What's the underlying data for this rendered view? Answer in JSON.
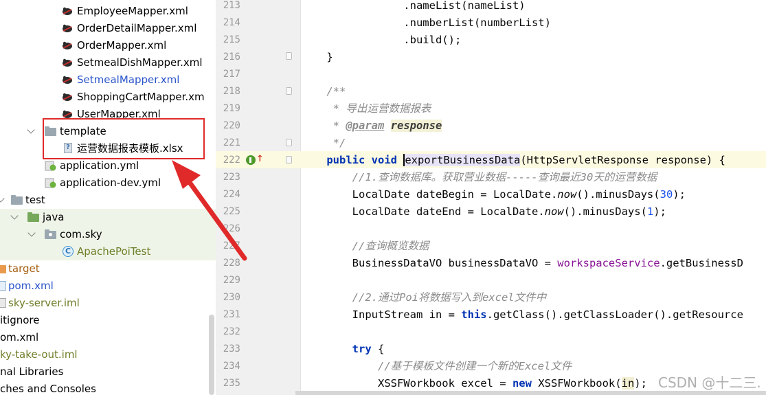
{
  "project_tree": {
    "mapper_files": [
      "EmployeeMapper.xml",
      "OrderDetailMapper.xml",
      "OrderMapper.xml",
      "SetmealDishMapper.xml",
      "SetmealMapper.xml",
      "ShoppingCartMapper.xm",
      "UserMapper.xml"
    ],
    "template_folder": "template",
    "template_file": "运营数据报表模板.xlsx",
    "application_yml": "application.yml",
    "application_dev_yml": "application-dev.yml",
    "test_folder": "test",
    "java_folder": "java",
    "package": "com.sky",
    "test_class": "ApachePoiTest",
    "target_folder": "target",
    "pom": "pom.xml",
    "server_iml": "sky-server.iml",
    "gitignore": "itignore",
    "root_pom": "om.xml",
    "root_iml": "ky-take-out.iml",
    "external_libraries": "nal Libraries",
    "scratches": "ches and Consoles"
  },
  "editor": {
    "line_numbers": [
      "213",
      "214",
      "215",
      "216",
      "217",
      "218",
      "219",
      "220",
      "221",
      "222",
      "223",
      "224",
      "225",
      "226",
      "227",
      "228",
      "229",
      "230",
      "231",
      "232",
      "233",
      "234",
      "235"
    ],
    "code": {
      "l213": "                .nameList(nameList)",
      "l214": "                .numberList(numberList)",
      "l215": "                .build();",
      "l216": "    }",
      "l217": "",
      "l218": "    /**",
      "l219": "     * 导出运营数据报表",
      "l220_tag": "@param",
      "l220_param": "response",
      "l221": "     */",
      "l222_kw": "public void",
      "l222_method": "exportBusinessData",
      "l222_rest": "(HttpServletResponse response) {",
      "l223": "        //1.查询数据库。获取营业数据-----查询最近30天的运营数据",
      "l224_a": "        LocalDate dateBegin = LocalDate.",
      "l224_b": "now",
      "l224_c": "().minusDays(",
      "l224_num": "30",
      "l224_d": ");",
      "l225_a": "        LocalDate dateEnd = LocalDate.",
      "l225_b": "now",
      "l225_c": "().minusDays(",
      "l225_num": "1",
      "l225_d": ");",
      "l227": "        //查询概览数据",
      "l228_a": "        BusinessDataVO businessDataVO = ",
      "l228_field": "workspaceService",
      "l228_b": ".getBusinessD",
      "l230": "        //2.通过Poi将数据写入到excel文件中",
      "l231_a": "        InputStream in = ",
      "l231_kw": "this",
      "l231_b": ".getClass().getClassLoader().getResource",
      "l233_kw": "try",
      "l233_rest": " {",
      "l234": "            //基于模板文件创建一个新的Excel文件",
      "l235_a": "            XSSFWorkbook excel = ",
      "l235_kw": "new",
      "l235_b": " XSSFWorkbook(",
      "l235_in": "in",
      "l235_c": ");"
    }
  },
  "watermark": "CSDN @十二三.",
  "colors": {
    "highlight_box": "#e02a2a",
    "keyword": "#0033b3",
    "comment": "#8c8c8c",
    "number": "#1750eb",
    "field": "#871094",
    "current_line": "#fcfae1"
  }
}
